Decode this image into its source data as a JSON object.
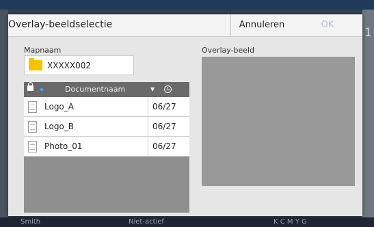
{
  "background": {
    "right_number": "1",
    "user": "Smith",
    "status": "Niet-actief",
    "ink_label": "K  C  M  Y  G"
  },
  "dialog": {
    "title": "Overlay-beeldselectie",
    "cancel_label": "Annuleren",
    "ok_label": "OK",
    "folder_label": "Mapnaam",
    "folder_name": "XXXXX002",
    "preview_label": "Overlay-beeld",
    "column_name": "Documentnaam",
    "files": [
      {
        "name": "Logo_A",
        "date": "06/27"
      },
      {
        "name": "Logo_B",
        "date": "06/27"
      },
      {
        "name": "Photo_01",
        "date": "06/27"
      }
    ]
  },
  "colors": {
    "folder": "#f5c300",
    "header": "#6a6a6a",
    "preview": "#999999",
    "sort_accent": "#4aa3e8"
  }
}
